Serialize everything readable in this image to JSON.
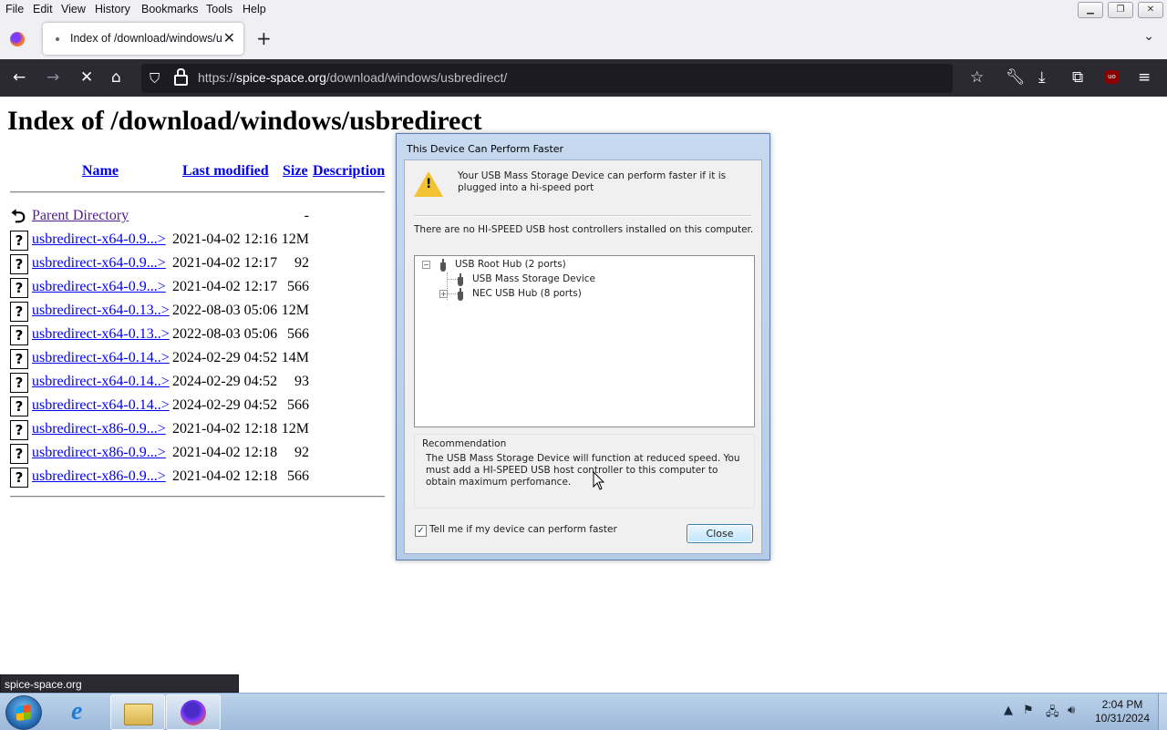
{
  "menubar": {
    "items": [
      "File",
      "Edit",
      "View",
      "History",
      "Bookmarks",
      "Tools",
      "Help"
    ],
    "accesskeys": [
      "F",
      "E",
      "V",
      "H",
      "B",
      "T",
      "H"
    ]
  },
  "window_controls": [
    "minimize-icon",
    "restore-icon",
    "close-icon"
  ],
  "tab": {
    "title": "Index of /download/windows/u"
  },
  "url": {
    "host": "spice-space.org",
    "path": "/download/windows/usbredirect/",
    "scheme": "https://"
  },
  "page": {
    "title": "Index of /download/windows/usbredirect",
    "headers": {
      "name": "Name",
      "modified": "Last modified",
      "size": "Size",
      "description": "Description"
    },
    "parent": {
      "name": "Parent Directory",
      "size": "-"
    },
    "files": [
      {
        "name": "usbredirect-x64-0.9...>",
        "date": "2021-04-02 12:16",
        "size": "12M"
      },
      {
        "name": "usbredirect-x64-0.9...>",
        "date": "2021-04-02 12:17",
        "size": "92"
      },
      {
        "name": "usbredirect-x64-0.9...>",
        "date": "2021-04-02 12:17",
        "size": "566"
      },
      {
        "name": "usbredirect-x64-0.13..>",
        "date": "2022-08-03 05:06",
        "size": "12M"
      },
      {
        "name": "usbredirect-x64-0.13..>",
        "date": "2022-08-03 05:06",
        "size": "566"
      },
      {
        "name": "usbredirect-x64-0.14..>",
        "date": "2024-02-29 04:52",
        "size": "14M"
      },
      {
        "name": "usbredirect-x64-0.14..>",
        "date": "2024-02-29 04:52",
        "size": "93"
      },
      {
        "name": "usbredirect-x64-0.14..>",
        "date": "2024-02-29 04:52",
        "size": "566"
      },
      {
        "name": "usbredirect-x86-0.9...>",
        "date": "2021-04-02 12:18",
        "size": "12M"
      },
      {
        "name": "usbredirect-x86-0.9...>",
        "date": "2021-04-02 12:18",
        "size": "92"
      },
      {
        "name": "usbredirect-x86-0.9...>",
        "date": "2021-04-02 12:18",
        "size": "566"
      }
    ]
  },
  "dialog": {
    "title": "This Device Can Perform Faster",
    "message": "Your USB Mass Storage Device can perform faster if it is plugged into a hi-speed port",
    "info": "There are no HI-SPEED USB host controllers installed on this computer.",
    "tree": [
      {
        "label": "USB Root Hub (2 ports)",
        "expander": "⊟"
      },
      {
        "label": "USB Mass Storage Device"
      },
      {
        "label": "NEC USB Hub (8 ports)",
        "expander": "⊞"
      }
    ],
    "recommendation_label": "Recommendation",
    "recommendation_text": "The USB Mass Storage Device will function at reduced speed. You must add a HI-SPEED USB host controller to this computer to obtain maximum perfomance.",
    "checkbox_label": "Tell me if my device can perform faster",
    "checkbox_checked": true,
    "close_label": "Close"
  },
  "status_text": "spice-space.org",
  "taskbar": {
    "time": "2:04 PM",
    "date": "10/31/2024"
  }
}
